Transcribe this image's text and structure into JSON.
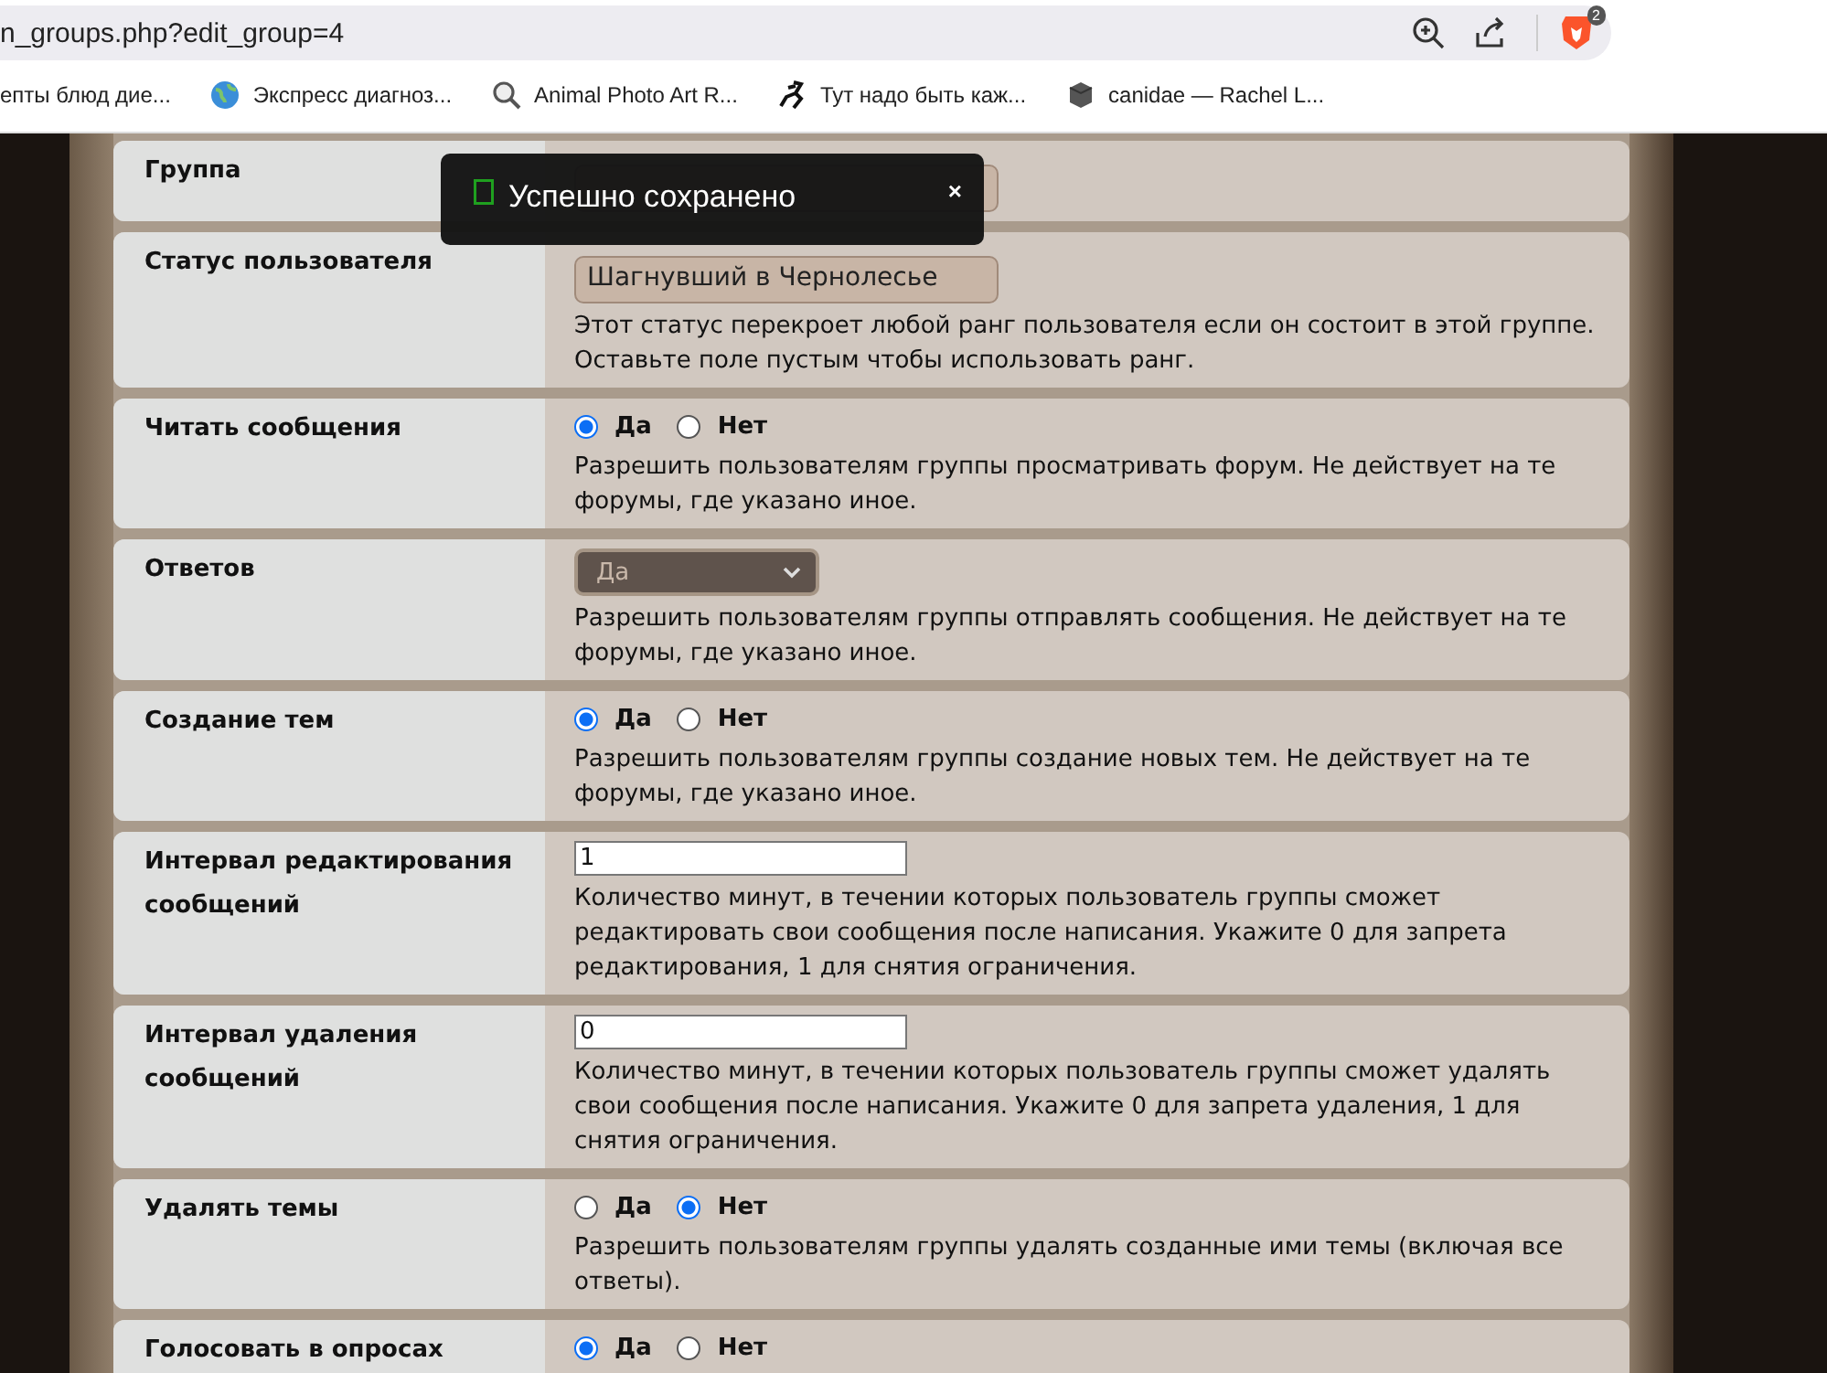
{
  "browser": {
    "url": "n_groups.php?edit_group=4",
    "badge": "2",
    "bookmarks": [
      {
        "kind": "none",
        "label": "епты блюд дие..."
      },
      {
        "kind": "globe",
        "label": "Экспресс диагноз..."
      },
      {
        "kind": "search",
        "label": "Animal Photo Art R..."
      },
      {
        "kind": "runner",
        "label": "Тут надо быть каж..."
      },
      {
        "kind": "cube",
        "label": "canidae — Rachel L..."
      }
    ]
  },
  "toast": {
    "message": "Успешно сохранено",
    "close": "×"
  },
  "rows": [
    {
      "kind": "text",
      "label": "Группа"
    },
    {
      "kind": "text",
      "label": "Статус пользователя",
      "value": "Шагнувший в Чернолесье",
      "description": "Этот статус перекроет любой ранг пользователя если он состоит в этой группе. Оставьте поле пустым чтобы использовать ранг."
    },
    {
      "kind": "radio",
      "label": "Читать сообщения",
      "options": [
        {
          "label": "Да",
          "selected": true
        },
        {
          "label": "Нет",
          "selected": false
        }
      ],
      "description": "Разрешить пользователям группы просматривать форум. Не действует на те форумы, где указано иное."
    },
    {
      "kind": "select",
      "label": "Ответов",
      "value": "Да",
      "description": "Разрешить пользователям группы отправлять сообщения. Не действует на те форумы, где указано иное."
    },
    {
      "kind": "radio",
      "label": "Создание тем",
      "options": [
        {
          "label": "Да",
          "selected": true
        },
        {
          "label": "Нет",
          "selected": false
        }
      ],
      "description": "Разрешить пользователям группы создание новых тем. Не действует на те форумы, где указано иное."
    },
    {
      "kind": "number",
      "label": "Интервал редактирования сообщений",
      "value": "1",
      "description": "Количество минут, в течении которых пользователь группы сможет редактировать свои сообщения после написания. Укажите 0 для запрета редактирования, 1 для снятия ограничения."
    },
    {
      "kind": "number",
      "label": "Интервал удаления сообщений",
      "value": "0",
      "description": "Количество минут, в течении которых пользователь группы сможет удалять свои сообщения после написания. Укажите 0 для запрета удаления, 1 для снятия ограничения."
    },
    {
      "kind": "radio",
      "label": "Удалять темы",
      "options": [
        {
          "label": "Да",
          "selected": false
        },
        {
          "label": "Нет",
          "selected": true
        }
      ],
      "description": "Разрешить пользователям группы удалять созданные ими темы (включая все ответы)."
    },
    {
      "kind": "radio",
      "label": "Голосовать в опросах",
      "options": [
        {
          "label": "Да",
          "selected": true
        },
        {
          "label": "Нет",
          "selected": false
        }
      ]
    }
  ]
}
